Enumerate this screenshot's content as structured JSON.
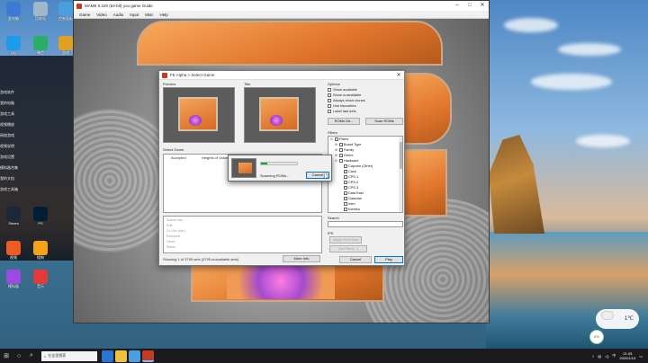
{
  "main_window": {
    "title": "MAME 0.220 (64-bit) you game Guide",
    "menu": [
      "Game",
      "Video",
      "Audio",
      "Input",
      "Misc",
      "Help"
    ],
    "controls": [
      "–",
      "□",
      "✕"
    ]
  },
  "dialog": {
    "title": "FE Alpha > Select Game",
    "preview_label": "Preview",
    "title_label": "Title",
    "select_game_label": "Select Game",
    "columns": [
      "Accepted",
      "Heights of Values"
    ],
    "info_lines": [
      "Source Info",
      "Drift",
      "Co Dev (info)",
      "Released",
      "Genre",
      "Series"
    ],
    "status_text": "Showing 1 of 3795 sets (3795 unavailable sets)",
    "buttons": {
      "more_info": "More Info",
      "cancel": "Cancel",
      "play": "Play",
      "roms_dir": "ROMs Dir...",
      "scan_roms": "Scan ROMs",
      "apply_filter": "Apply Find Now",
      "set_filter": "Set Filter(...)"
    },
    "options_label": "Options",
    "options": [
      "Show available",
      "Show unavailable",
      "Always show clones",
      "Use favourites",
      "Label last sets"
    ],
    "filters_label": "Filters",
    "filter_tree": [
      {
        "label": "Filters",
        "level": 0,
        "exp": "⊟"
      },
      {
        "label": "Board Type",
        "level": 1,
        "exp": "⊞"
      },
      {
        "label": "Family",
        "level": 1,
        "exp": "⊞"
      },
      {
        "label": "Genre",
        "level": 1,
        "exp": "⊞"
      },
      {
        "label": "Hardware",
        "level": 1,
        "exp": "⊟"
      },
      {
        "label": "Capcom (Other)",
        "level": 2,
        "exp": ""
      },
      {
        "label": "Cave",
        "level": 2,
        "exp": ""
      },
      {
        "label": "CPS-1",
        "level": 2,
        "exp": ""
      },
      {
        "label": "CPS-2",
        "level": 2,
        "exp": ""
      },
      {
        "label": "CPS-3",
        "level": 2,
        "exp": ""
      },
      {
        "label": "Data East",
        "level": 2,
        "exp": ""
      },
      {
        "label": "Galaxian",
        "level": 2,
        "exp": ""
      },
      {
        "label": "Irem",
        "level": 2,
        "exp": ""
      },
      {
        "label": "Kaneko",
        "level": 2,
        "exp": ""
      }
    ],
    "search_label": "Search",
    "ips_label": "IPS"
  },
  "scan_popup": {
    "text": "Scanning ROMs...",
    "cancel_label": "Cancel",
    "progress": 0.18,
    "progress_color": "#06b025"
  },
  "desktop_icons": [
    {
      "label": "此电脑",
      "color": "#3a7bd5"
    },
    {
      "label": "回收站",
      "color": "#9fb7c9"
    },
    {
      "label": "控制面板",
      "color": "#4a9fe0"
    },
    {
      "label": "QQ",
      "color": "#1e9bea"
    },
    {
      "label": "微信",
      "color": "#2aae67"
    },
    {
      "label": "游戏",
      "color": "#e0a020"
    },
    {
      "label": "Steam",
      "color": "#1b2838"
    },
    {
      "label": "PS",
      "color": "#001e36"
    },
    {
      "label": "视频",
      "color": "#ef5b25"
    },
    {
      "label": "搜狗",
      "color": "#f7a21b"
    },
    {
      "label": "模拟器",
      "color": "#9a4be0"
    },
    {
      "label": "音乐",
      "color": "#e23a3a"
    }
  ],
  "desktop_side_text": [
    "游戏软件",
    "我的电脑",
    "游戏工具",
    "视频播放",
    "网络游戏",
    "视频说明",
    "游戏设置",
    "模拟器合集",
    "我的文档",
    "游戏工具箱"
  ],
  "taskbar": {
    "search_placeholder": "在这里搜索",
    "time": "21:05",
    "date": "2020/1/13",
    "tray_lang": "中"
  },
  "weather": {
    "temp": "1℃"
  },
  "gadget": {
    "text": "6%"
  }
}
